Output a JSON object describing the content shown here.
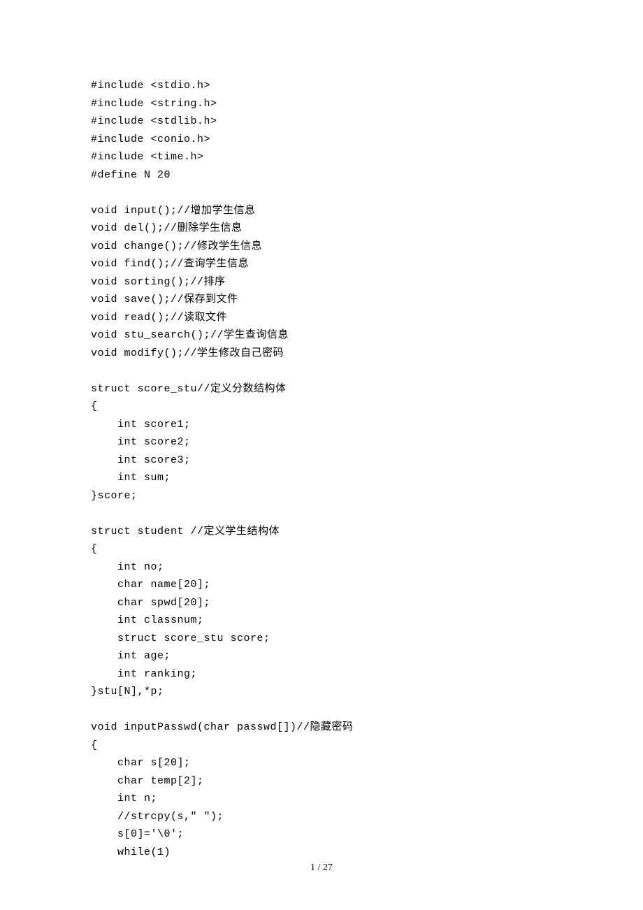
{
  "code_lines": [
    "#include <stdio.h>",
    "#include <string.h>",
    "#include <stdlib.h>",
    "#include <conio.h>",
    "#include <time.h>",
    "#define N 20",
    "",
    "void input();//增加学生信息",
    "void del();//删除学生信息",
    "void change();//修改学生信息",
    "void find();//查询学生信息",
    "void sorting();//排序",
    "void save();//保存到文件",
    "void read();//读取文件",
    "void stu_search();//学生查询信息",
    "void modify();//学生修改自己密码",
    "",
    "struct score_stu//定义分数结构体",
    "{",
    "    int score1;",
    "    int score2;",
    "    int score3;",
    "    int sum;",
    "}score;",
    "",
    "struct student //定义学生结构体",
    "{",
    "    int no;",
    "    char name[20];",
    "    char spwd[20];",
    "    int classnum;",
    "    struct score_stu score;",
    "    int age;",
    "    int ranking;",
    "}stu[N],*p;",
    "",
    "void inputPasswd(char passwd[])//隐藏密码",
    "{",
    "    char s[20];",
    "    char temp[2];",
    "    int n;",
    "    //strcpy(s,\" \");",
    "    s[0]='\\0';",
    "    while(1)"
  ],
  "page_number": "1 / 27"
}
